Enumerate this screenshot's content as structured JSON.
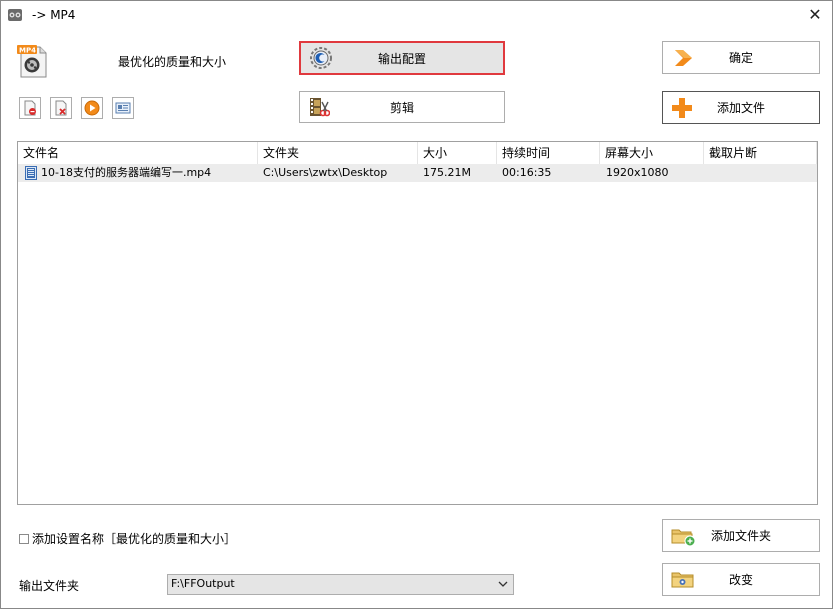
{
  "window": {
    "title": "-> MP4",
    "close_glyph": "✕"
  },
  "preset": {
    "label": "最优化的质量和大小",
    "icon": "mp4-file-icon"
  },
  "buttons": {
    "output_config": "输出配置",
    "edit": "剪辑",
    "ok": "确定",
    "add_file": "添加文件",
    "add_folder": "添加文件夹",
    "change": "改变"
  },
  "toolbar_icons": [
    "remove-file-icon",
    "clear-list-icon",
    "play-icon",
    "info-icon"
  ],
  "file_list": {
    "columns": [
      "文件名",
      "文件夹",
      "大小",
      "持续时间",
      "屏幕大小",
      "截取片断"
    ],
    "rows": [
      {
        "name": "10-18支付的服务器端编写一.mp4",
        "folder": "C:\\Users\\zwtx\\Desktop",
        "size": "175.21M",
        "duration": "00:16:35",
        "resolution": "1920x1080",
        "clip": ""
      }
    ]
  },
  "add_setting_name": {
    "label": "添加设置名称［最优化的质量和大小］",
    "checked": false
  },
  "output_folder": {
    "label": "输出文件夹",
    "value": "F:\\FFOutput"
  },
  "colors": {
    "highlight_border": "#e0393e",
    "accent_orange": "#f28a1a"
  }
}
